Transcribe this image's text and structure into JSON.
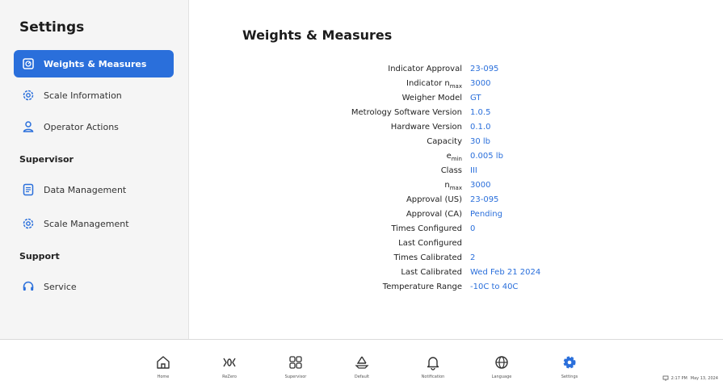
{
  "sidebar": {
    "title": "Settings",
    "items": [
      {
        "label": "Weights & Measures",
        "icon": "scale-icon",
        "active": true
      },
      {
        "label": "Scale Information",
        "icon": "gear-icon"
      },
      {
        "label": "Operator Actions",
        "icon": "person-icon"
      }
    ],
    "sections": [
      {
        "label": "Supervisor",
        "items": [
          {
            "label": "Data Management",
            "icon": "document-icon"
          },
          {
            "label": "Scale Management",
            "icon": "gear-icon"
          }
        ]
      },
      {
        "label": "Support",
        "items": [
          {
            "label": "Service",
            "icon": "headset-icon"
          }
        ]
      }
    ]
  },
  "main": {
    "title": "Weights & Measures",
    "properties": [
      {
        "label": "Indicator Approval",
        "value": "23-095"
      },
      {
        "label": "Indicator n",
        "sub": "max",
        "value": "3000"
      },
      {
        "label": "Weigher Model",
        "value": "GT"
      },
      {
        "label": "Metrology Software Version",
        "value": "1.0.5"
      },
      {
        "label": "Hardware Version",
        "value": "0.1.0"
      },
      {
        "label": "Capacity",
        "value": "30 lb"
      },
      {
        "label": "e",
        "sub": "min",
        "value": "0.005 lb"
      },
      {
        "label": "Class",
        "value": "III"
      },
      {
        "label": "n",
        "sub": "max",
        "value": "3000"
      },
      {
        "label": "Approval (US)",
        "value": "23-095"
      },
      {
        "label": "Approval (CA)",
        "value": "Pending"
      },
      {
        "label": "Times Configured",
        "value": "0"
      },
      {
        "label": "Last Configured",
        "value": ""
      },
      {
        "label": "Times Calibrated",
        "value": "2"
      },
      {
        "label": "Last Calibrated",
        "value": "Wed Feb 21 2024"
      },
      {
        "label": "Temperature Range",
        "value": "-10C to 40C"
      }
    ]
  },
  "bottombar": {
    "tabs": [
      {
        "label": "Home",
        "icon": "home-icon"
      },
      {
        "label": "ReZero",
        "icon": "rezero-icon"
      },
      {
        "label": "Supervisor",
        "icon": "grid-icon"
      },
      {
        "label": "Default",
        "icon": "recycle-icon"
      },
      {
        "label": "Notification",
        "icon": "bell-icon"
      },
      {
        "label": "Language",
        "icon": "globe-icon"
      },
      {
        "label": "Settings",
        "icon": "gear-icon",
        "active": true
      }
    ],
    "status": {
      "time": "2:17 PM",
      "date": "May 13, 2024"
    }
  },
  "colors": {
    "accent": "#2a6fdb",
    "sidebar_bg": "#f5f5f5"
  }
}
